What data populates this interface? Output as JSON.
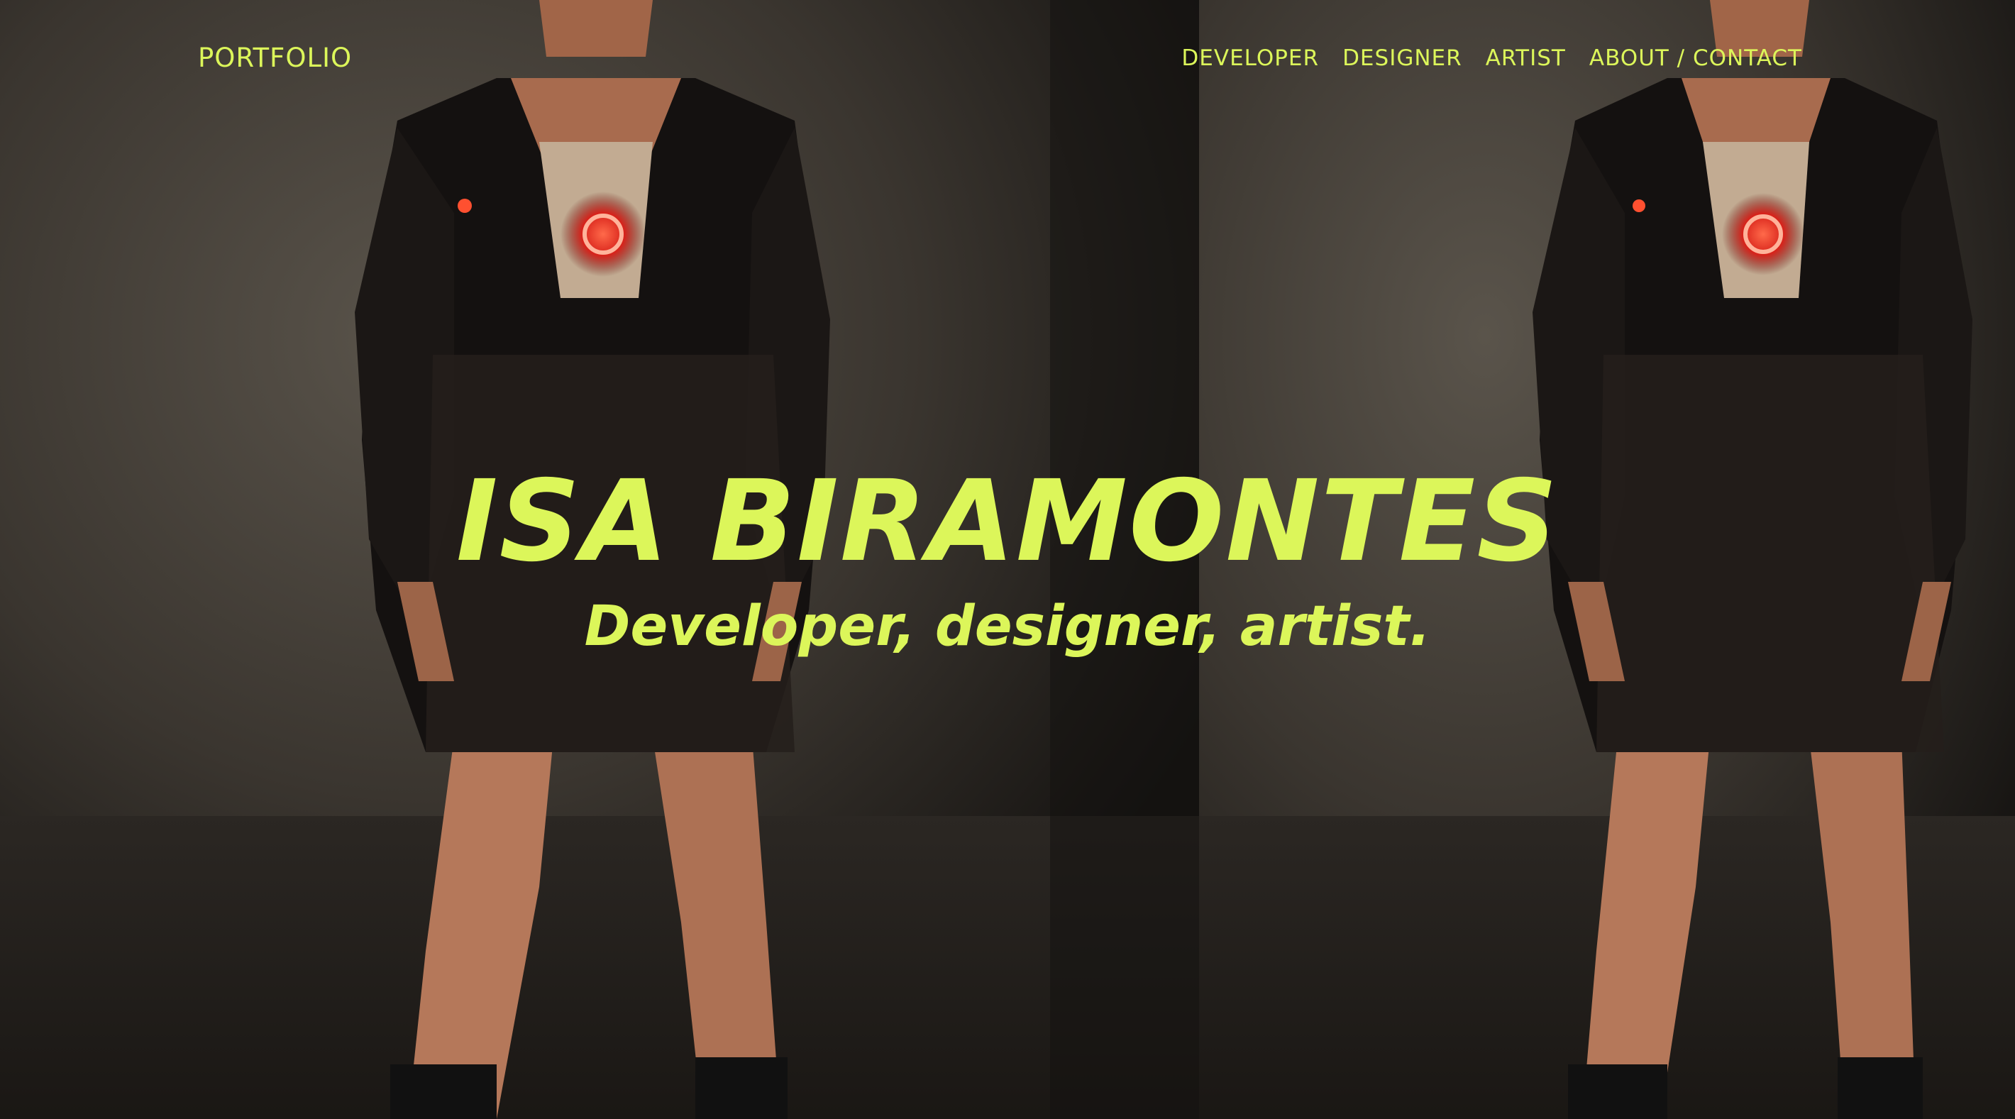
{
  "theme": {
    "accent": "#dcf65a",
    "background": "#1e1b17"
  },
  "header": {
    "brand": "PORTFOLIO",
    "nav": [
      {
        "label": "DEVELOPER"
      },
      {
        "label": "DESIGNER"
      },
      {
        "label": "ARTIST"
      },
      {
        "label": "ABOUT / CONTACT"
      }
    ]
  },
  "hero": {
    "title": "ISA BIRAMONTES",
    "subtitle": "Developer, designer, artist."
  },
  "background": {
    "panels": [
      {
        "subject": "model-wearing-black-dress-with-led-heart"
      },
      {
        "subject": "model-wearing-black-dress-with-led-heart"
      }
    ]
  }
}
